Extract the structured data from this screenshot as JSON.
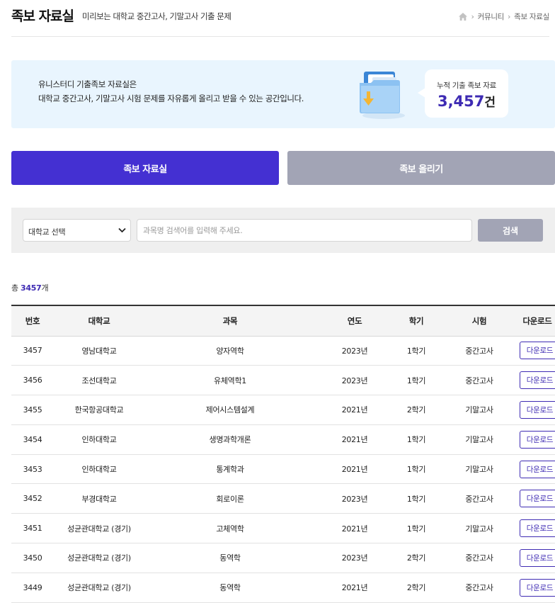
{
  "header": {
    "title": "족보 자료실",
    "subtitle": "미리보는 대학교 중간고사, 기말고사 기출 문제",
    "breadcrumb": [
      "커뮤니티",
      "족보 자료실"
    ]
  },
  "banner": {
    "line1": "유니스터디 기출족보 자료실은",
    "line2": "대학교 중간고사, 기말고사 시험 문제를 자유롭게 올리고 받을 수 있는 공간입니다.",
    "stat_label": "누적 기출 족보 자료",
    "stat_value": "3,457",
    "stat_unit": "건"
  },
  "tabs": [
    {
      "label": "족보 자료실",
      "active": true
    },
    {
      "label": "족보 올리기",
      "active": false
    }
  ],
  "search": {
    "select_value": "대학교 선택",
    "placeholder": "과목명 검색어를 입력해 주세요.",
    "button_label": "검색"
  },
  "total": {
    "prefix": "총",
    "count": "3457",
    "suffix": "개"
  },
  "table": {
    "columns": [
      "번호",
      "대학교",
      "과목",
      "연도",
      "학기",
      "시험",
      "다운로드"
    ],
    "download_label": "다운로드",
    "rows": [
      {
        "no": "3457",
        "university": "영남대학교",
        "subject": "양자역학",
        "year": "2023년",
        "semester": "1학기",
        "exam": "중간고사"
      },
      {
        "no": "3456",
        "university": "조선대학교",
        "subject": "유체역학1",
        "year": "2023년",
        "semester": "1학기",
        "exam": "중간고사"
      },
      {
        "no": "3455",
        "university": "한국항공대학교",
        "subject": "제어시스템설계",
        "year": "2021년",
        "semester": "2학기",
        "exam": "기말고사"
      },
      {
        "no": "3454",
        "university": "인하대학교",
        "subject": "생명과학개론",
        "year": "2021년",
        "semester": "1학기",
        "exam": "기말고사"
      },
      {
        "no": "3453",
        "university": "인하대학교",
        "subject": "통계학과",
        "year": "2021년",
        "semester": "1학기",
        "exam": "기말고사"
      },
      {
        "no": "3452",
        "university": "부경대학교",
        "subject": "회로이론",
        "year": "2023년",
        "semester": "1학기",
        "exam": "중간고사"
      },
      {
        "no": "3451",
        "university": "성균관대학교 (경기)",
        "subject": "고체역학",
        "year": "2021년",
        "semester": "1학기",
        "exam": "기말고사"
      },
      {
        "no": "3450",
        "university": "성균관대학교 (경기)",
        "subject": "동역학",
        "year": "2023년",
        "semester": "2학기",
        "exam": "중간고사"
      },
      {
        "no": "3449",
        "university": "성균관대학교 (경기)",
        "subject": "동역학",
        "year": "2021년",
        "semester": "2학기",
        "exam": "중간고사"
      }
    ]
  },
  "icons": {
    "home": "home-icon",
    "breadcrumb_separator": "chevron-right-icon",
    "select_arrow": "chevron-down-icon",
    "banner_folder": "folder-download-icon"
  },
  "colors": {
    "accent": "#4430d2",
    "accent_text": "#3e2bb3",
    "inactive": "#a2a4b5",
    "banner_bg": "#e9f5fe"
  }
}
